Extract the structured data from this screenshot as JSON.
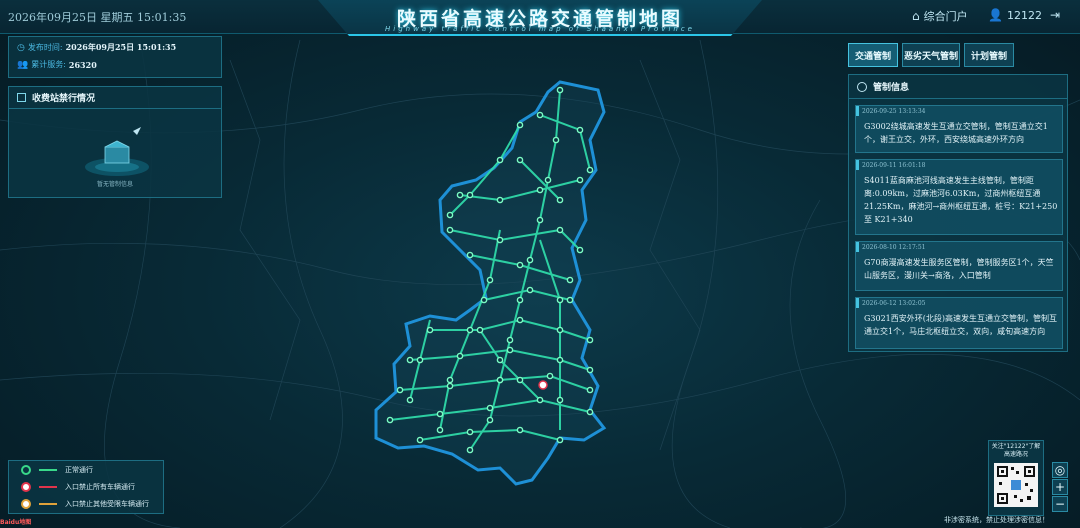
{
  "header": {
    "datetime": "2026年09月25日 星期五  15:01:35",
    "title": "陕西省高速公路交通管制地图",
    "subtitle": "Highway traffic control map of Shaanxi Province",
    "portal_label": "综合门户",
    "user_label": "12122"
  },
  "info": {
    "publish_label": "发布时间:",
    "publish_value": "2026年09月25日  15:01:35",
    "service_label": "累计服务:",
    "service_value": "26320"
  },
  "toll_panel": {
    "title": "收费站禁行情况",
    "empty_text": "暂无管制信息"
  },
  "tabs": [
    "交通管制",
    "恶劣天气管制",
    "计划管制"
  ],
  "control_panel": {
    "title": "管制信息",
    "items": [
      {
        "time": "2026-09-25 13:13:34",
        "text": "G3002绕城高速发生互通立交管制，管制互通立交1个，谢王立交，外环，西安绕城高速外环方向"
      },
      {
        "time": "2026-09-11 16:01:18",
        "text": "S4011蓝商麻池河线高速发生主线管制，管制距离:0.09km，过麻池河6.03Km，过商州枢纽互通21.25Km，麻池河→商州枢纽互通，桩号：K21+250 至 K21+340"
      },
      {
        "time": "2026-08-10 12:17:51",
        "text": "G70商漫高速发生服务区管制，管制服务区1个，天竺山服务区，漫川关→商洛，入口管制"
      },
      {
        "time": "2026-06-12 13:02:05",
        "text": "G3021西安外环(北段)高速发生互通立交管制，管制互通立交1个，马庄北枢纽立交，双向，咸旬高速方向"
      }
    ]
  },
  "legend": {
    "items": [
      {
        "label": "正常通行",
        "color": "#39d98a"
      },
      {
        "label": "入口禁止所有车辆通行",
        "color": "#e0344b"
      },
      {
        "label": "入口禁止其他受限车辆通行",
        "color": "#e0a23a"
      }
    ]
  },
  "qr": {
    "caption": "关注\"12122\"了解高速路况"
  },
  "footer": {
    "note": "非涉密系统，禁止处理涉密信息！",
    "logo": "Baidu地图"
  },
  "colors": {
    "accent": "#2bc6e8",
    "road": "#2fd9a8",
    "border": "#1e90d6"
  }
}
